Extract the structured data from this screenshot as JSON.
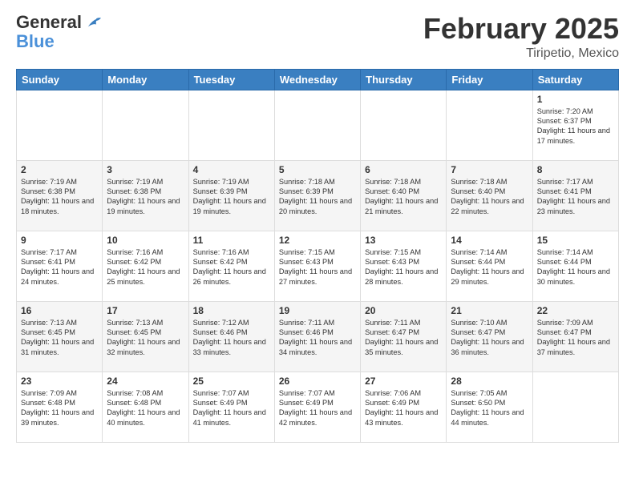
{
  "header": {
    "logo_general": "General",
    "logo_blue": "Blue",
    "month": "February 2025",
    "location": "Tiripetio, Mexico"
  },
  "weekdays": [
    "Sunday",
    "Monday",
    "Tuesday",
    "Wednesday",
    "Thursday",
    "Friday",
    "Saturday"
  ],
  "weeks": [
    [
      {
        "day": "",
        "info": ""
      },
      {
        "day": "",
        "info": ""
      },
      {
        "day": "",
        "info": ""
      },
      {
        "day": "",
        "info": ""
      },
      {
        "day": "",
        "info": ""
      },
      {
        "day": "",
        "info": ""
      },
      {
        "day": "1",
        "info": "Sunrise: 7:20 AM\nSunset: 6:37 PM\nDaylight: 11 hours and 17 minutes."
      }
    ],
    [
      {
        "day": "2",
        "info": "Sunrise: 7:19 AM\nSunset: 6:38 PM\nDaylight: 11 hours and 18 minutes."
      },
      {
        "day": "3",
        "info": "Sunrise: 7:19 AM\nSunset: 6:38 PM\nDaylight: 11 hours and 19 minutes."
      },
      {
        "day": "4",
        "info": "Sunrise: 7:19 AM\nSunset: 6:39 PM\nDaylight: 11 hours and 19 minutes."
      },
      {
        "day": "5",
        "info": "Sunrise: 7:18 AM\nSunset: 6:39 PM\nDaylight: 11 hours and 20 minutes."
      },
      {
        "day": "6",
        "info": "Sunrise: 7:18 AM\nSunset: 6:40 PM\nDaylight: 11 hours and 21 minutes."
      },
      {
        "day": "7",
        "info": "Sunrise: 7:18 AM\nSunset: 6:40 PM\nDaylight: 11 hours and 22 minutes."
      },
      {
        "day": "8",
        "info": "Sunrise: 7:17 AM\nSunset: 6:41 PM\nDaylight: 11 hours and 23 minutes."
      }
    ],
    [
      {
        "day": "9",
        "info": "Sunrise: 7:17 AM\nSunset: 6:41 PM\nDaylight: 11 hours and 24 minutes."
      },
      {
        "day": "10",
        "info": "Sunrise: 7:16 AM\nSunset: 6:42 PM\nDaylight: 11 hours and 25 minutes."
      },
      {
        "day": "11",
        "info": "Sunrise: 7:16 AM\nSunset: 6:42 PM\nDaylight: 11 hours and 26 minutes."
      },
      {
        "day": "12",
        "info": "Sunrise: 7:15 AM\nSunset: 6:43 PM\nDaylight: 11 hours and 27 minutes."
      },
      {
        "day": "13",
        "info": "Sunrise: 7:15 AM\nSunset: 6:43 PM\nDaylight: 11 hours and 28 minutes."
      },
      {
        "day": "14",
        "info": "Sunrise: 7:14 AM\nSunset: 6:44 PM\nDaylight: 11 hours and 29 minutes."
      },
      {
        "day": "15",
        "info": "Sunrise: 7:14 AM\nSunset: 6:44 PM\nDaylight: 11 hours and 30 minutes."
      }
    ],
    [
      {
        "day": "16",
        "info": "Sunrise: 7:13 AM\nSunset: 6:45 PM\nDaylight: 11 hours and 31 minutes."
      },
      {
        "day": "17",
        "info": "Sunrise: 7:13 AM\nSunset: 6:45 PM\nDaylight: 11 hours and 32 minutes."
      },
      {
        "day": "18",
        "info": "Sunrise: 7:12 AM\nSunset: 6:46 PM\nDaylight: 11 hours and 33 minutes."
      },
      {
        "day": "19",
        "info": "Sunrise: 7:11 AM\nSunset: 6:46 PM\nDaylight: 11 hours and 34 minutes."
      },
      {
        "day": "20",
        "info": "Sunrise: 7:11 AM\nSunset: 6:47 PM\nDaylight: 11 hours and 35 minutes."
      },
      {
        "day": "21",
        "info": "Sunrise: 7:10 AM\nSunset: 6:47 PM\nDaylight: 11 hours and 36 minutes."
      },
      {
        "day": "22",
        "info": "Sunrise: 7:09 AM\nSunset: 6:47 PM\nDaylight: 11 hours and 37 minutes."
      }
    ],
    [
      {
        "day": "23",
        "info": "Sunrise: 7:09 AM\nSunset: 6:48 PM\nDaylight: 11 hours and 39 minutes."
      },
      {
        "day": "24",
        "info": "Sunrise: 7:08 AM\nSunset: 6:48 PM\nDaylight: 11 hours and 40 minutes."
      },
      {
        "day": "25",
        "info": "Sunrise: 7:07 AM\nSunset: 6:49 PM\nDaylight: 11 hours and 41 minutes."
      },
      {
        "day": "26",
        "info": "Sunrise: 7:07 AM\nSunset: 6:49 PM\nDaylight: 11 hours and 42 minutes."
      },
      {
        "day": "27",
        "info": "Sunrise: 7:06 AM\nSunset: 6:49 PM\nDaylight: 11 hours and 43 minutes."
      },
      {
        "day": "28",
        "info": "Sunrise: 7:05 AM\nSunset: 6:50 PM\nDaylight: 11 hours and 44 minutes."
      },
      {
        "day": "",
        "info": ""
      }
    ]
  ]
}
